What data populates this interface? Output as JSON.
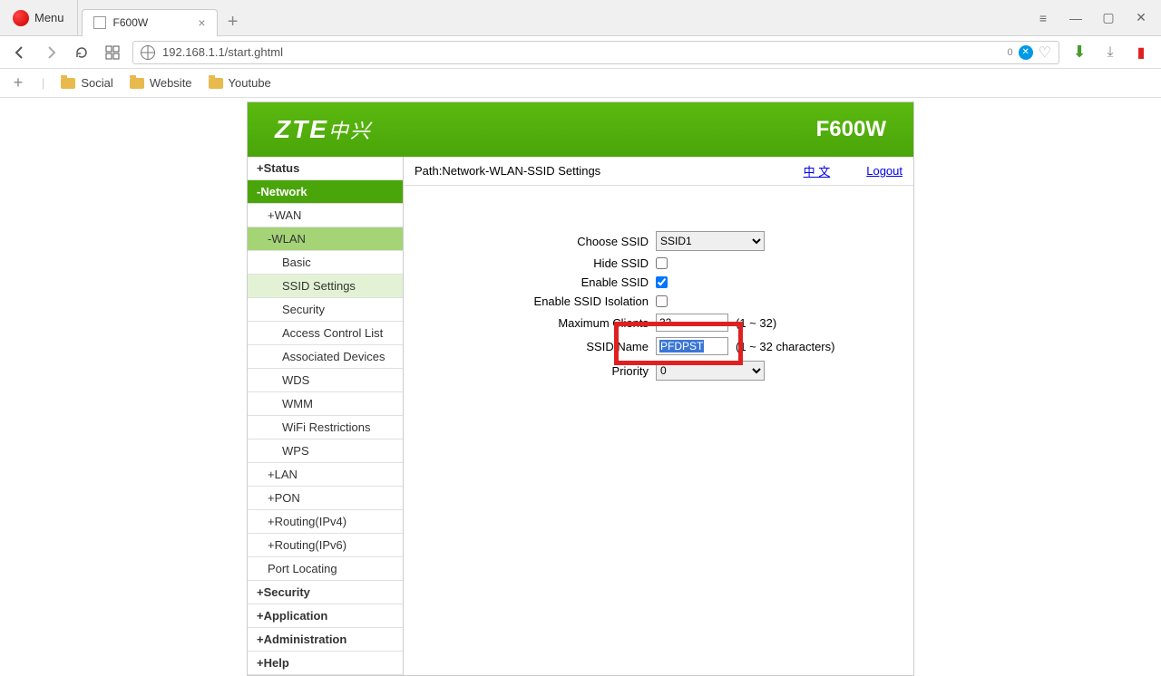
{
  "browser": {
    "menu": "Menu",
    "tab_title": "F600W",
    "url": "192.168.1.1/start.ghtml",
    "badge_count": "0",
    "bookmarks": [
      "Social",
      "Website",
      "Youtube"
    ]
  },
  "router": {
    "brand": "ZTE",
    "brand_cn": "中兴",
    "model": "F600W",
    "path_label": "Path:Network-WLAN-SSID Settings",
    "lang_link": "中 文",
    "logout": "Logout"
  },
  "sidebar": {
    "status": "+Status",
    "network": "-Network",
    "wan": "+WAN",
    "wlan": "-WLAN",
    "wlan_items": [
      "Basic",
      "SSID Settings",
      "Security",
      "Access Control List",
      "Associated Devices",
      "WDS",
      "WMM",
      "WiFi Restrictions",
      "WPS"
    ],
    "lan": "+LAN",
    "pon": "+PON",
    "routing4": "+Routing(IPv4)",
    "routing6": "+Routing(IPv6)",
    "port_locating": "Port Locating",
    "security": "+Security",
    "application": "+Application",
    "administration": "+Administration",
    "help": "+Help"
  },
  "form": {
    "choose_ssid_label": "Choose SSID",
    "choose_ssid_value": "SSID1",
    "hide_ssid_label": "Hide SSID",
    "enable_ssid_label": "Enable SSID",
    "isolation_label": "Enable SSID Isolation",
    "max_clients_label": "Maximum Clients",
    "max_clients_value": "32",
    "max_clients_hint": "(1 ~ 32)",
    "ssid_name_label": "SSID Name",
    "ssid_name_value": "PFDPST",
    "ssid_name_hint": "(1 ~ 32 characters)",
    "priority_label": "Priority",
    "priority_value": "0"
  }
}
